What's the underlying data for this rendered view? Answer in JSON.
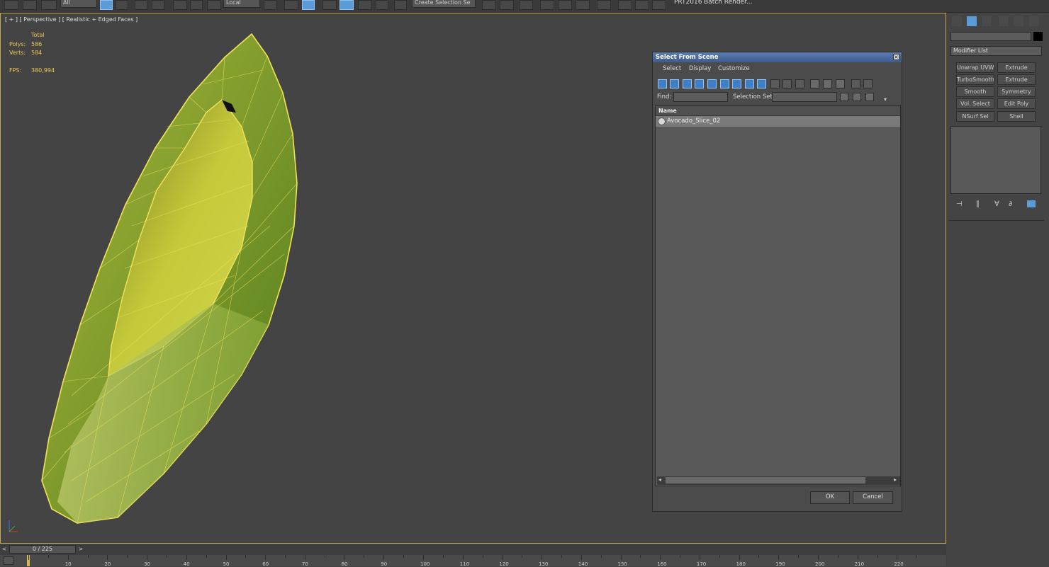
{
  "toolbar": {
    "filter_combo": "All",
    "coord_combo": "Local",
    "selection_set_combo": "Create Selection Se",
    "prt_label": "PRT2016",
    "batch_render_label": "Batch Render..."
  },
  "viewport": {
    "label": "[ + ] [ Perspective ] [ Realistic + Edged Faces ]",
    "stats": {
      "total_label": "Total",
      "polys_label": "Polys:",
      "polys_value": "586",
      "verts_label": "Verts:",
      "verts_value": "584",
      "fps_label": "FPS:",
      "fps_value": "380,994"
    }
  },
  "dialog": {
    "title": "Select From Scene",
    "close": "×",
    "menu": [
      "Select",
      "Display",
      "Customize"
    ],
    "find_label": "Find:",
    "find_value": "",
    "selection_set_label": "Selection Set:",
    "selection_set_value": "",
    "column_name": "Name",
    "items": [
      {
        "name": "Avocado_Slice_02"
      }
    ],
    "ok_label": "OK",
    "cancel_label": "Cancel"
  },
  "command_panel": {
    "modifier_list": "Modifier List",
    "modifiers": [
      "Unwrap UVW",
      "Extrude",
      "TurboSmooth",
      "Extrude",
      "Smooth",
      "Symmetry",
      "Vol. Select",
      "Edit Poly",
      "NSurf Sel",
      "Shell"
    ]
  },
  "timeline": {
    "frame_display": "0 / 225",
    "prev": "<",
    "next": ">",
    "ticks": [
      "10",
      "20",
      "30",
      "40",
      "50",
      "60",
      "70",
      "80",
      "90",
      "100",
      "110",
      "120",
      "130",
      "140",
      "150",
      "160",
      "170",
      "180",
      "190",
      "200",
      "210",
      "220"
    ]
  },
  "colors": {
    "accent_blue": "#3f7fc8",
    "stats_yellow": "#e9c957",
    "viewport_border": "#c6a84f",
    "mesh_outer": "#7d9a2a",
    "mesh_inner": "#c8cc3a",
    "wire": "#f2e25a"
  }
}
